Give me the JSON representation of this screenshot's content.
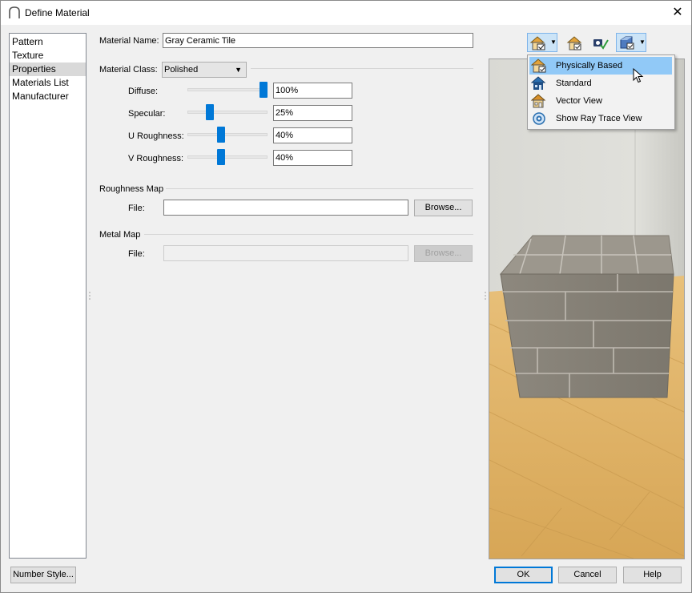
{
  "window": {
    "title": "Define Material",
    "close_label": "✕"
  },
  "nav": {
    "items": [
      {
        "label": "Pattern"
      },
      {
        "label": "Texture"
      },
      {
        "label": "Properties",
        "selected": true
      },
      {
        "label": "Materials List"
      },
      {
        "label": "Manufacturer"
      }
    ]
  },
  "material_name": {
    "label": "Material Name:",
    "value": "Gray Ceramic Tile"
  },
  "material_class": {
    "label": "Material Class:",
    "value": "Polished"
  },
  "sliders": {
    "diffuse": {
      "label": "Diffuse:",
      "value": "100%",
      "percent": 100
    },
    "specular": {
      "label": "Specular:",
      "value": "25%",
      "percent": 25
    },
    "u_roughness": {
      "label": "U Roughness:",
      "value": "40%",
      "percent": 40
    },
    "v_roughness": {
      "label": "V Roughness:",
      "value": "40%",
      "percent": 40
    }
  },
  "roughness_map": {
    "heading": "Roughness Map",
    "file_label": "File:",
    "file_value": "",
    "browse_label": "Browse..."
  },
  "metal_map": {
    "heading": "Metal Map",
    "file_label": "File:",
    "file_value": "",
    "browse_label": "Browse..."
  },
  "footer": {
    "number_style_label": "Number Style...",
    "ok_label": "OK",
    "cancel_label": "Cancel",
    "help_label": "Help"
  },
  "render_menu": {
    "items": [
      {
        "label": "Physically Based",
        "icon": "physically-based-icon",
        "hover": true
      },
      {
        "label": "Standard",
        "icon": "standard-view-icon"
      },
      {
        "label": "Vector View",
        "icon": "vector-view-icon"
      },
      {
        "label": "Show Ray Trace View",
        "icon": "ray-trace-icon"
      }
    ]
  },
  "colors": {
    "accent": "#0078d7",
    "menu_hover": "#91c9f7",
    "floor_wood": "#e3b96c",
    "tile_gray": "#8c877e"
  }
}
